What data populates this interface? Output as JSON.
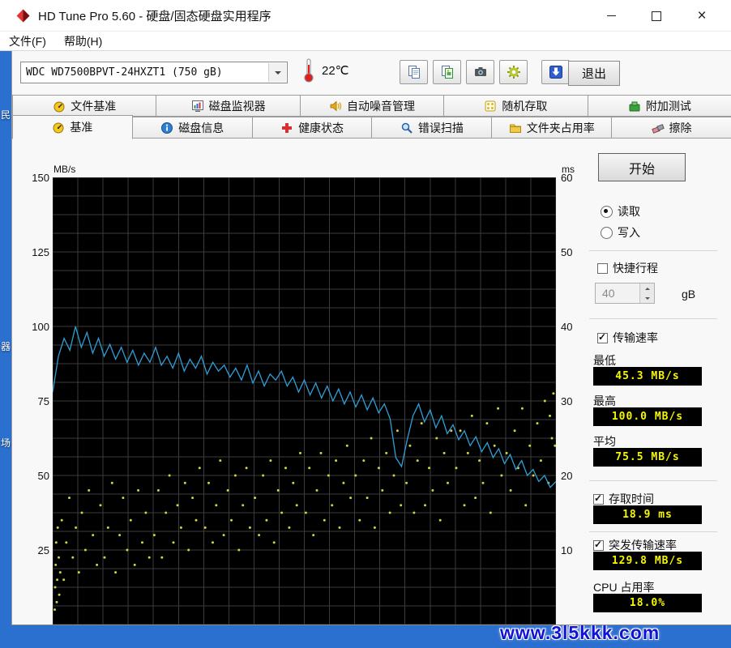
{
  "window": {
    "title": "HD Tune Pro 5.60 - 硬盘/固态硬盘实用程序"
  },
  "menu": {
    "items": [
      {
        "label": "文件(F)"
      },
      {
        "label": "帮助(H)"
      }
    ]
  },
  "toolbar": {
    "drive_select": "WDC WD7500BPVT-24HXZT1 (750 gB)",
    "temperature": "22℃",
    "exit_label": "退出"
  },
  "tabs": {
    "row1": [
      {
        "label": "文件基准"
      },
      {
        "label": "磁盘监视器"
      },
      {
        "label": "自动噪音管理"
      },
      {
        "label": "随机存取"
      },
      {
        "label": "附加测试"
      }
    ],
    "row2": [
      {
        "label": "基准",
        "active": true
      },
      {
        "label": "磁盘信息",
        "active": false
      },
      {
        "label": "健康状态",
        "active": false
      },
      {
        "label": "错误扫描",
        "active": false
      },
      {
        "label": "文件夹占用率",
        "active": false
      },
      {
        "label": "擦除",
        "active": false
      }
    ]
  },
  "panel": {
    "start_label": "开始",
    "read": {
      "label": "读取",
      "selected": true
    },
    "write": {
      "label": "写入",
      "selected": false
    },
    "short_stroke": {
      "label": "快捷行程",
      "checked": false,
      "value": "40",
      "unit": "gB"
    },
    "transfer": {
      "label": "传输速率",
      "checked": true,
      "min_label": "最低",
      "min_value": "45.3 MB/s",
      "max_label": "最高",
      "max_value": "100.0 MB/s",
      "avg_label": "平均",
      "avg_value": "75.5 MB/s"
    },
    "access": {
      "label": "存取时间",
      "checked": true,
      "value": "18.9 ms"
    },
    "burst": {
      "label": "突发传输速率",
      "checked": true,
      "value": "129.8 MB/s"
    },
    "cpu": {
      "label": "CPU 占用率",
      "value": "18.0%"
    }
  },
  "chart_data": {
    "type": "line+scatter",
    "title": "HD Tune benchmark (read)",
    "bg": "#000000",
    "grid": {
      "v_divisions": 20,
      "h_divisions": 24,
      "color": "#3c3c3c"
    },
    "left_axis": {
      "label": "MB/s",
      "min": 0,
      "max": 150,
      "ticks": [
        150,
        125,
        100,
        75,
        50,
        25
      ]
    },
    "right_axis": {
      "label": "ms",
      "min": 0,
      "max": 60,
      "ticks": [
        60,
        50,
        40,
        30,
        20,
        10
      ]
    },
    "transfer_line": {
      "name": "transfer-rate",
      "color": "#2f9fd8",
      "x_range": [
        0,
        1
      ],
      "values": [
        78,
        90,
        96,
        92,
        100,
        93,
        98,
        91,
        96,
        90,
        94,
        89,
        93,
        88,
        92,
        87,
        91,
        88,
        93,
        87,
        90,
        86,
        91,
        85,
        89,
        86,
        90,
        84,
        88,
        85,
        87,
        83,
        86,
        82,
        87,
        81,
        85,
        80,
        84,
        82,
        85,
        80,
        83,
        78,
        82,
        77,
        81,
        76,
        80,
        75,
        79,
        74,
        78,
        73,
        77,
        72,
        76,
        71,
        74,
        69,
        56,
        53,
        62,
        70,
        74,
        68,
        72,
        66,
        70,
        64,
        67,
        62,
        65,
        60,
        63,
        58,
        61,
        56,
        59,
        54,
        57,
        52,
        55,
        50,
        52,
        48,
        50,
        46,
        48
      ]
    },
    "access_points": {
      "name": "access-time",
      "color": "#d2d23c",
      "points": [
        [
          0.004,
          2
        ],
        [
          0.005,
          5
        ],
        [
          0.006,
          8
        ],
        [
          0.007,
          11
        ],
        [
          0.008,
          3
        ],
        [
          0.009,
          6
        ],
        [
          0.01,
          13
        ],
        [
          0.012,
          9
        ],
        [
          0.013,
          4
        ],
        [
          0.015,
          7
        ],
        [
          0.018,
          14
        ],
        [
          0.022,
          6
        ],
        [
          0.027,
          11
        ],
        [
          0.033,
          17
        ],
        [
          0.04,
          9
        ],
        [
          0.046,
          13
        ],
        [
          0.052,
          7
        ],
        [
          0.058,
          15
        ],
        [
          0.065,
          10
        ],
        [
          0.072,
          18
        ],
        [
          0.08,
          12
        ],
        [
          0.088,
          8
        ],
        [
          0.095,
          16
        ],
        [
          0.103,
          9
        ],
        [
          0.11,
          13
        ],
        [
          0.118,
          19
        ],
        [
          0.125,
          7
        ],
        [
          0.133,
          12
        ],
        [
          0.14,
          17
        ],
        [
          0.148,
          10
        ],
        [
          0.155,
          14
        ],
        [
          0.163,
          8
        ],
        [
          0.17,
          18
        ],
        [
          0.178,
          11
        ],
        [
          0.185,
          15
        ],
        [
          0.192,
          9
        ],
        [
          0.202,
          12
        ],
        [
          0.21,
          18
        ],
        [
          0.217,
          9
        ],
        [
          0.225,
          15
        ],
        [
          0.232,
          20
        ],
        [
          0.24,
          11
        ],
        [
          0.248,
          16
        ],
        [
          0.255,
          13
        ],
        [
          0.263,
          19
        ],
        [
          0.27,
          10
        ],
        [
          0.278,
          17
        ],
        [
          0.285,
          14
        ],
        [
          0.292,
          21
        ],
        [
          0.303,
          13
        ],
        [
          0.31,
          19
        ],
        [
          0.318,
          11
        ],
        [
          0.325,
          16
        ],
        [
          0.333,
          22
        ],
        [
          0.34,
          12
        ],
        [
          0.348,
          18
        ],
        [
          0.355,
          14
        ],
        [
          0.363,
          20
        ],
        [
          0.37,
          10
        ],
        [
          0.378,
          16
        ],
        [
          0.385,
          21
        ],
        [
          0.392,
          13
        ],
        [
          0.402,
          17
        ],
        [
          0.41,
          12
        ],
        [
          0.418,
          20
        ],
        [
          0.425,
          14
        ],
        [
          0.433,
          22
        ],
        [
          0.44,
          11
        ],
        [
          0.448,
          18
        ],
        [
          0.455,
          15
        ],
        [
          0.463,
          21
        ],
        [
          0.47,
          13
        ],
        [
          0.478,
          19
        ],
        [
          0.485,
          16
        ],
        [
          0.492,
          23
        ],
        [
          0.503,
          15
        ],
        [
          0.51,
          21
        ],
        [
          0.518,
          12
        ],
        [
          0.525,
          18
        ],
        [
          0.533,
          23
        ],
        [
          0.54,
          14
        ],
        [
          0.548,
          20
        ],
        [
          0.555,
          16
        ],
        [
          0.563,
          22
        ],
        [
          0.57,
          13
        ],
        [
          0.578,
          19
        ],
        [
          0.585,
          24
        ],
        [
          0.592,
          17
        ],
        [
          0.602,
          20
        ],
        [
          0.61,
          14
        ],
        [
          0.618,
          22
        ],
        [
          0.625,
          17
        ],
        [
          0.633,
          25
        ],
        [
          0.64,
          13
        ],
        [
          0.648,
          21
        ],
        [
          0.655,
          18
        ],
        [
          0.663,
          23
        ],
        [
          0.67,
          15
        ],
        [
          0.678,
          20
        ],
        [
          0.685,
          26
        ],
        [
          0.692,
          16
        ],
        [
          0.703,
          19
        ],
        [
          0.71,
          24
        ],
        [
          0.718,
          15
        ],
        [
          0.725,
          22
        ],
        [
          0.733,
          27
        ],
        [
          0.74,
          16
        ],
        [
          0.748,
          21
        ],
        [
          0.755,
          18
        ],
        [
          0.763,
          25
        ],
        [
          0.77,
          14
        ],
        [
          0.778,
          23
        ],
        [
          0.785,
          19
        ],
        [
          0.792,
          26
        ],
        [
          0.802,
          21
        ],
        [
          0.81,
          26
        ],
        [
          0.818,
          16
        ],
        [
          0.825,
          23
        ],
        [
          0.833,
          28
        ],
        [
          0.84,
          17
        ],
        [
          0.848,
          22
        ],
        [
          0.855,
          19
        ],
        [
          0.863,
          27
        ],
        [
          0.87,
          15
        ],
        [
          0.878,
          24
        ],
        [
          0.885,
          29
        ],
        [
          0.892,
          20
        ],
        [
          0.902,
          23
        ],
        [
          0.91,
          18
        ],
        [
          0.918,
          26
        ],
        [
          0.925,
          21
        ],
        [
          0.933,
          29
        ],
        [
          0.94,
          16
        ],
        [
          0.948,
          24
        ],
        [
          0.955,
          20
        ],
        [
          0.963,
          27
        ],
        [
          0.97,
          22
        ],
        [
          0.978,
          30
        ],
        [
          0.985,
          19
        ],
        [
          0.992,
          25
        ],
        [
          0.988,
          28
        ],
        [
          0.995,
          31
        ],
        [
          0.998,
          24
        ]
      ]
    }
  },
  "desktop": {
    "watermark": "www.3l5kkk.com",
    "icon_labels": [
      {
        "text": "民"
      },
      {
        "text": "器"
      },
      {
        "text": "场"
      }
    ]
  }
}
